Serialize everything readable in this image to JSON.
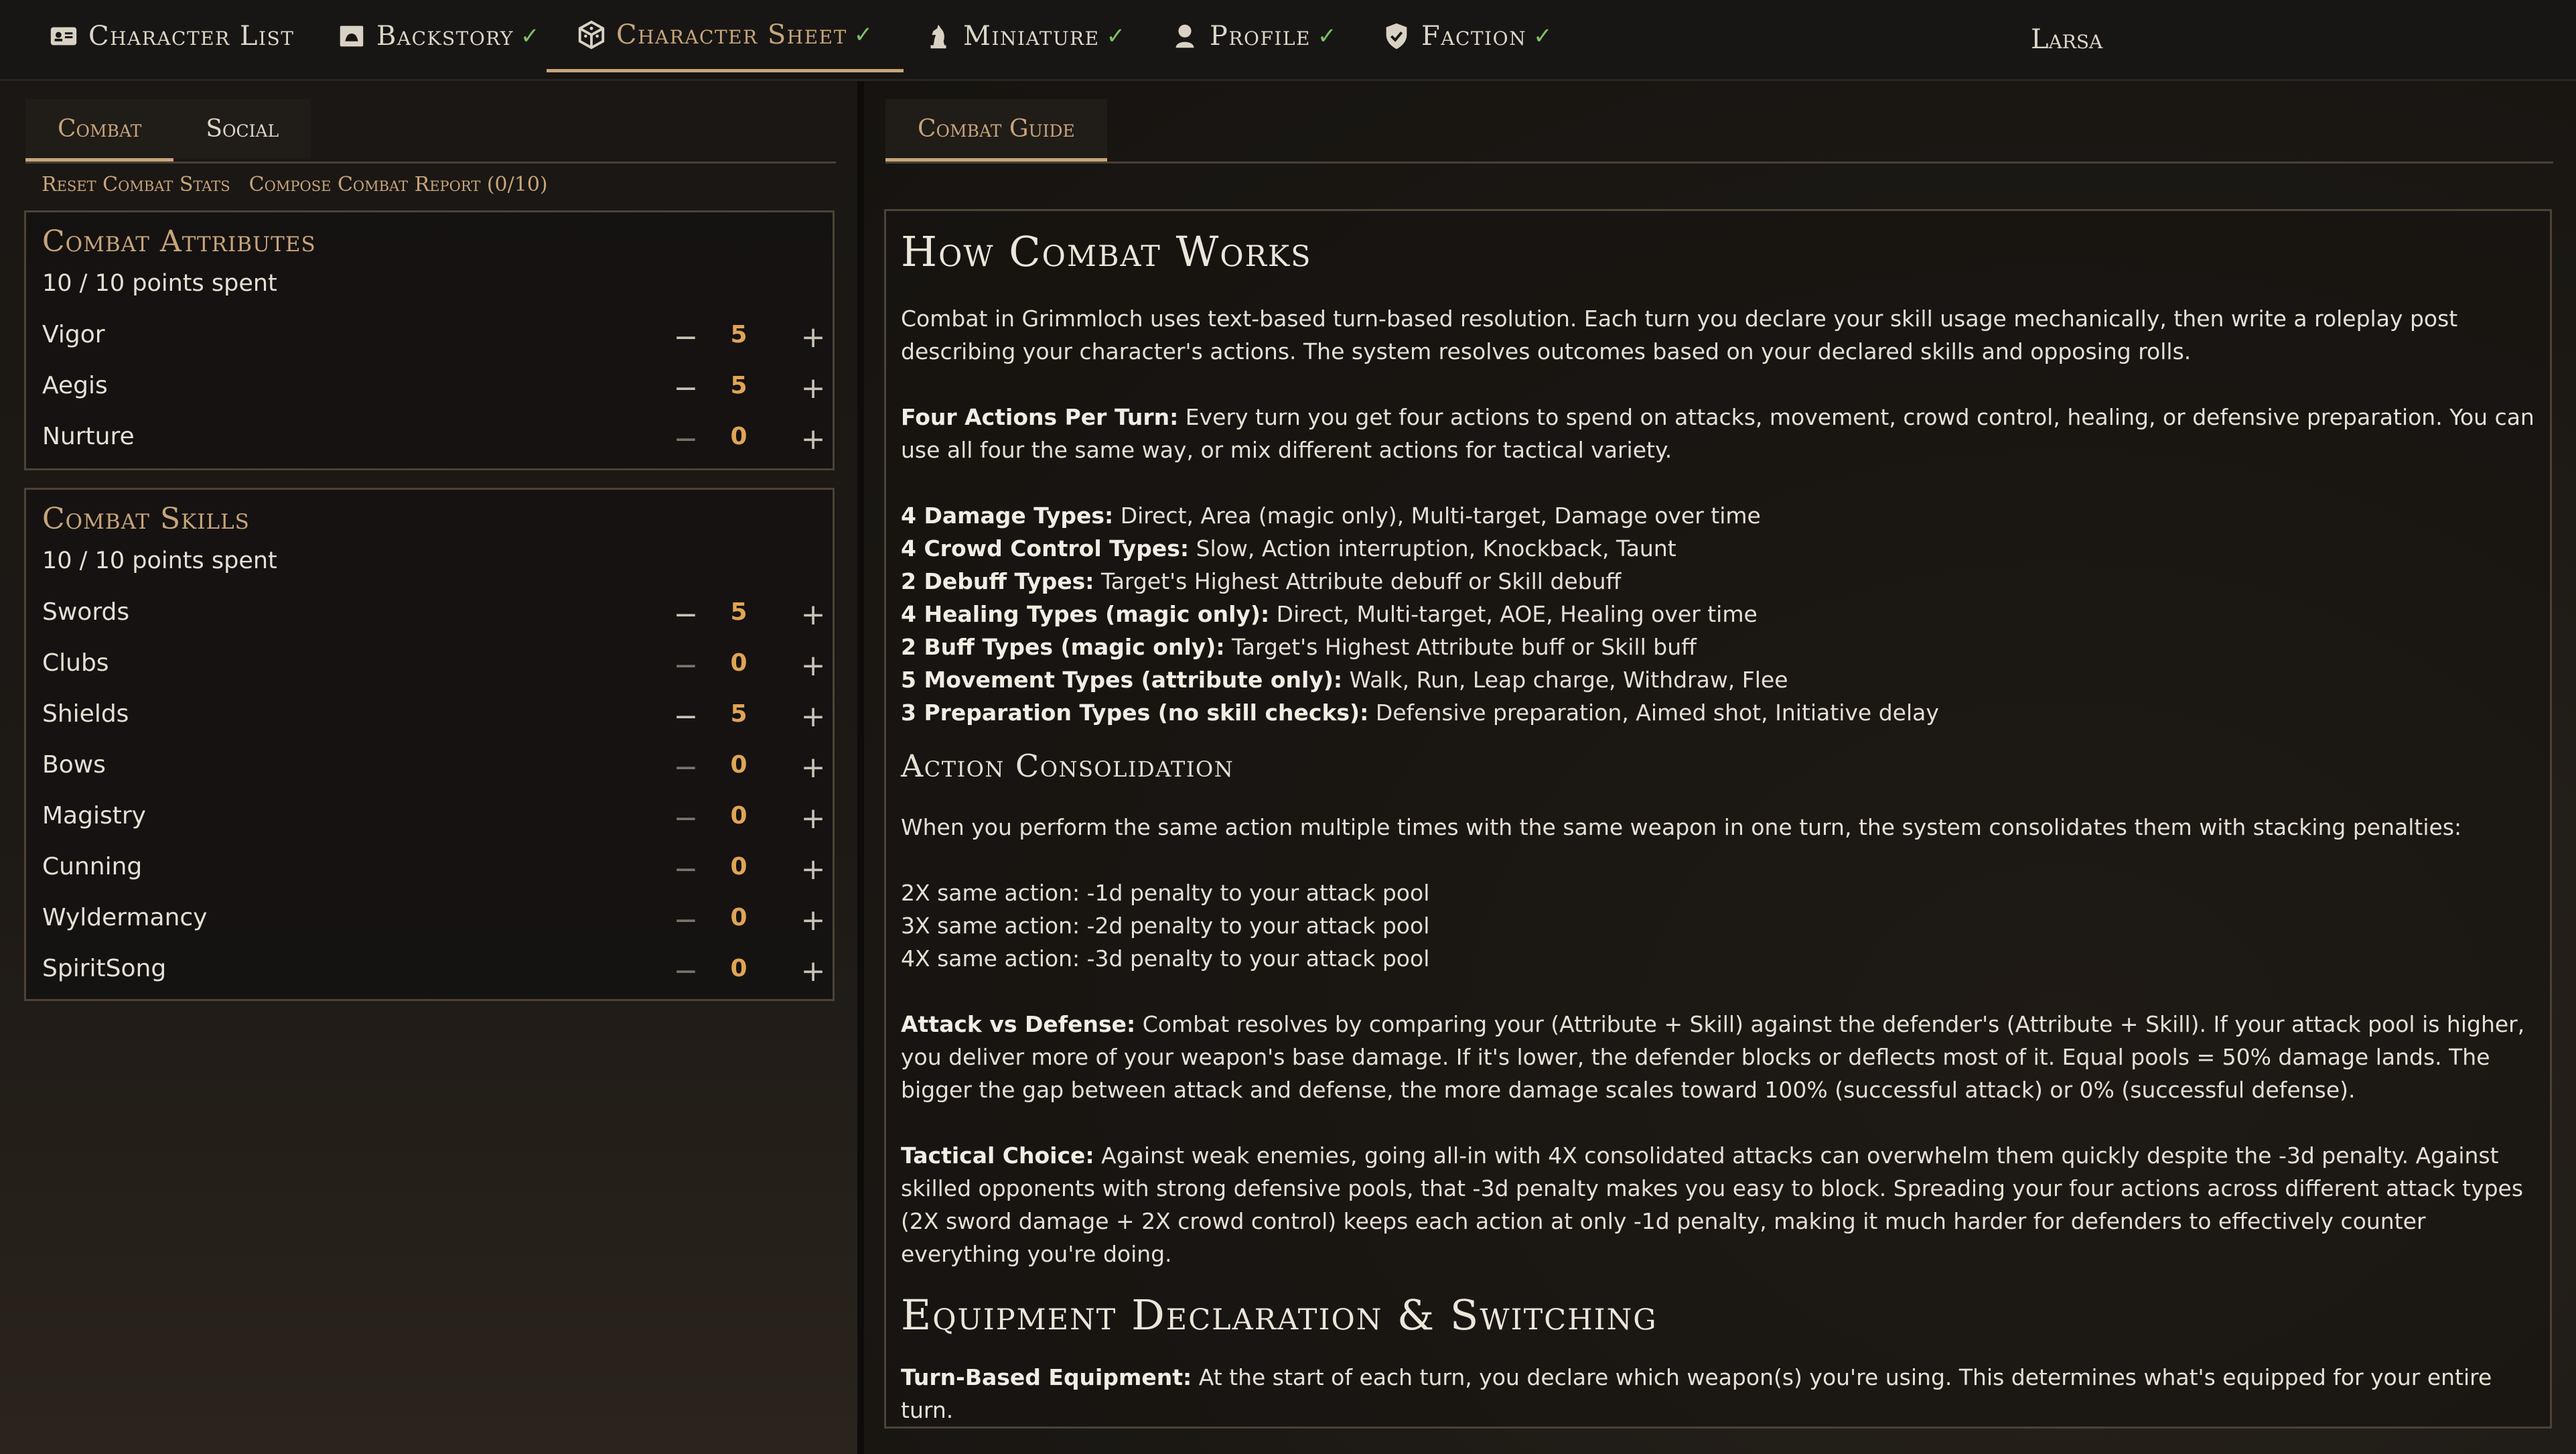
{
  "nav": {
    "tabs": [
      {
        "label": "Character List",
        "icon": "id-card-icon",
        "check": ""
      },
      {
        "label": "Backstory",
        "icon": "scroll-icon",
        "check": "✓"
      },
      {
        "label": "Character Sheet",
        "icon": "dice-icon",
        "check": "✓"
      },
      {
        "label": "Miniature",
        "icon": "chess-knight-icon",
        "check": "✓"
      },
      {
        "label": "Profile",
        "icon": "person-icon",
        "check": "✓"
      },
      {
        "label": "Faction",
        "icon": "shield-icon",
        "check": "✓"
      }
    ],
    "active_index": 2,
    "user": "Larsa"
  },
  "left": {
    "tabs": [
      "Combat",
      "Social"
    ],
    "actions": [
      "Reset Combat Stats",
      "Compose Combat Report (0/10)"
    ],
    "attributes": {
      "title": "Combat Attributes",
      "points": "10 / 10 points spent",
      "items": [
        {
          "name": "Vigor",
          "value": "5"
        },
        {
          "name": "Aegis",
          "value": "5"
        },
        {
          "name": "Nurture",
          "value": "0"
        }
      ]
    },
    "skills": {
      "title": "Combat Skills",
      "points": "10 / 10 points spent",
      "items": [
        {
          "name": "Swords",
          "value": "5"
        },
        {
          "name": "Clubs",
          "value": "0"
        },
        {
          "name": "Shields",
          "value": "5"
        },
        {
          "name": "Bows",
          "value": "0"
        },
        {
          "name": "Magistry",
          "value": "0"
        },
        {
          "name": "Cunning",
          "value": "0"
        },
        {
          "name": "Wyldermancy",
          "value": "0"
        },
        {
          "name": "SpiritSong",
          "value": "0"
        }
      ]
    },
    "minus_symbol": "−",
    "plus_symbol": "+"
  },
  "right": {
    "tab": "Combat Guide",
    "h1": "How Combat Works",
    "intro": "Combat in Grimmloch uses text-based turn-based resolution. Each turn you declare your skill usage mechanically, then write a roleplay post describing your character's actions. The system resolves outcomes based on your declared skills and opposing rolls.",
    "four_actions": {
      "bold": "Four Actions Per Turn:",
      "text": " Every turn you get four actions to spend on attacks, movement, crowd control, healing, or defensive preparation. You can use all four the same way, or mix different actions for tactical variety."
    },
    "types": [
      {
        "bold": "4 Damage Types:",
        "text": " Direct, Area (magic only), Multi-target, Damage over time"
      },
      {
        "bold": "4 Crowd Control Types:",
        "text": " Slow, Action interruption, Knockback, Taunt"
      },
      {
        "bold": "2 Debuff Types:",
        "text": " Target's Highest Attribute debuff or Skill debuff"
      },
      {
        "bold": "4 Healing Types (magic only):",
        "text": " Direct, Multi-target, AOE, Healing over time"
      },
      {
        "bold": "2 Buff Types (magic only):",
        "text": " Target's Highest Attribute buff or Skill buff"
      },
      {
        "bold": "5 Movement Types (attribute only):",
        "text": " Walk, Run, Leap charge, Withdraw, Flee"
      },
      {
        "bold": "3 Preparation Types (no skill checks):",
        "text": " Defensive preparation, Aimed shot, Initiative delay"
      }
    ],
    "h2_consolidation": "Action Consolidation",
    "consolidation_text": "When you perform the same action multiple times with the same weapon in one turn, the system consolidates them with stacking penalties:",
    "penalties": [
      "2X same action: -1d penalty to your attack pool",
      "3X same action: -2d penalty to your attack pool",
      "4X same action: -3d penalty to your attack pool"
    ],
    "attack_defense": {
      "bold": "Attack vs Defense:",
      "text": " Combat resolves by comparing your (Attribute + Skill) against the defender's (Attribute + Skill). If your attack pool is higher, you deliver more of your weapon's base damage. If it's lower, the defender blocks or deflects most of it. Equal pools = 50% damage lands. The bigger the gap between attack and defense, the more damage scales toward 100% (successful attack) or 0% (successful defense)."
    },
    "tactical": {
      "bold": "Tactical Choice:",
      "text": " Against weak enemies, going all-in with 4X consolidated attacks can overwhelm them quickly despite the -3d penalty. Against skilled opponents with strong defensive pools, that -3d penalty makes you easy to block. Spreading your four actions across different attack types (2X sword damage + 2X crowd control) keeps each action at only -1d penalty, making it much harder for defenders to effectively counter everything you're doing."
    },
    "h1_equipment": "Equipment Declaration & Switching",
    "equipment": {
      "bold": "Turn-Based Equipment:",
      "text": " At the start of each turn, you declare which weapon(s) you're using. This determines what's equipped for your entire turn."
    }
  },
  "colors": {
    "accent": "#c8a57a",
    "check": "#7fc168",
    "value": "#e0a455"
  }
}
